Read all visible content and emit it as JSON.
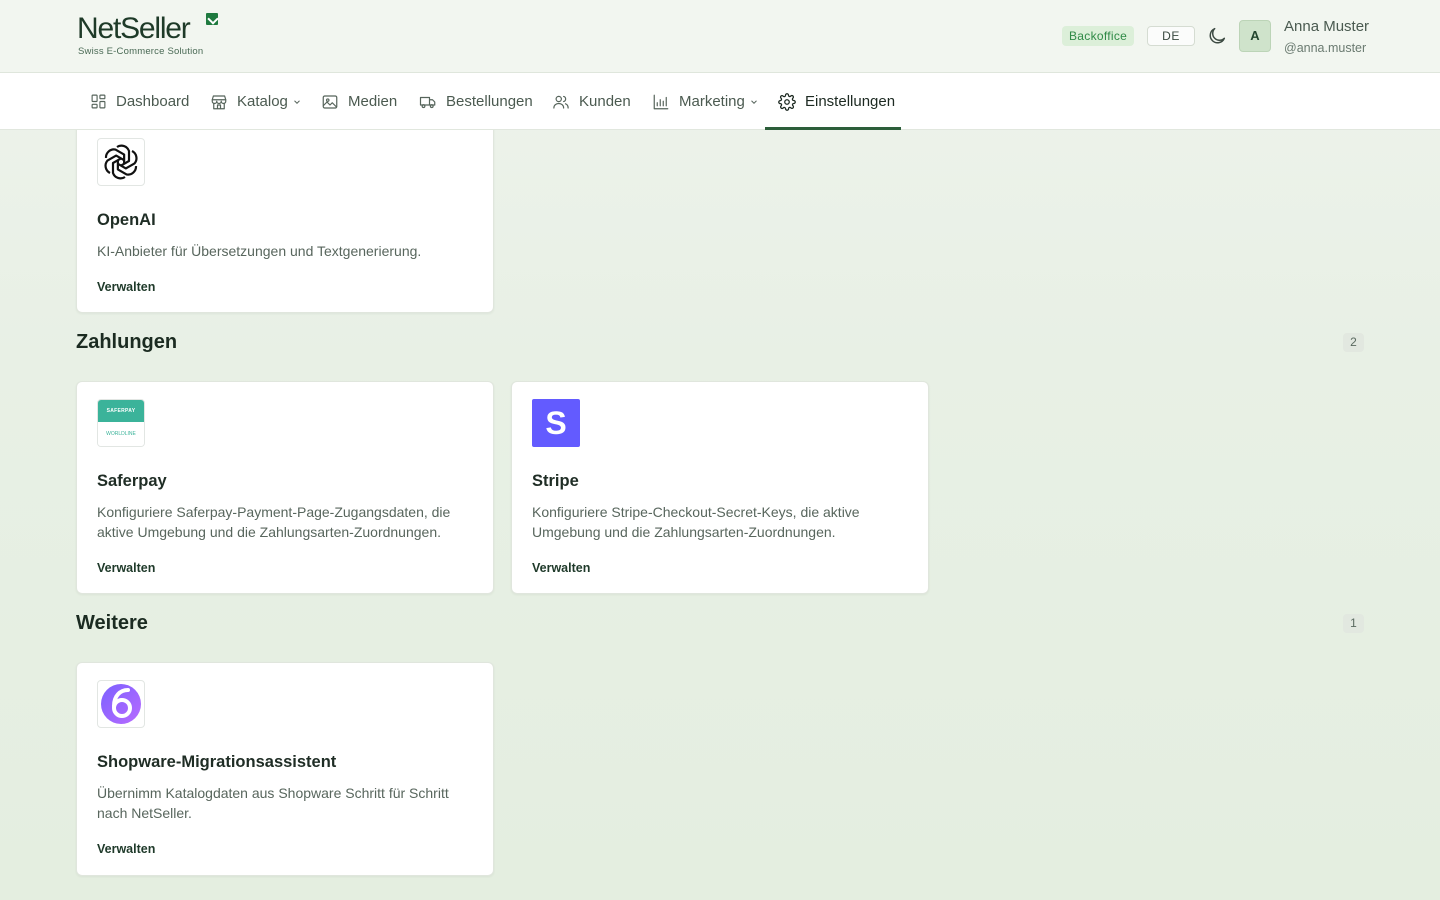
{
  "brand": {
    "name": "NetSeller",
    "tagline": "Swiss E-Commerce Solution"
  },
  "header": {
    "backoffice_badge": "Backoffice",
    "language": "DE",
    "user_initial": "A",
    "user_name": "Anna Muster",
    "user_handle": "@anna.muster"
  },
  "nav": {
    "items": [
      {
        "label": "Dashboard",
        "icon": "dashboard-icon"
      },
      {
        "label": "Katalog",
        "icon": "store-icon",
        "dropdown": true
      },
      {
        "label": "Medien",
        "icon": "image-icon"
      },
      {
        "label": "Bestellungen",
        "icon": "truck-icon"
      },
      {
        "label": "Kunden",
        "icon": "users-icon"
      },
      {
        "label": "Marketing",
        "icon": "chart-icon",
        "dropdown": true
      },
      {
        "label": "Einstellungen",
        "icon": "gear-icon",
        "active": true
      }
    ]
  },
  "cards": {
    "openai": {
      "title": "OpenAI",
      "description": "KI-Anbieter für Übersetzungen und Textgenerierung.",
      "link": "Verwalten"
    },
    "saferpay": {
      "title": "Saferpay",
      "description": "Konfiguriere Saferpay-Payment-Page-Zugangsdaten, die aktive Umgebung und die Zahlungsarten-Zuordnungen.",
      "link": "Verwalten",
      "logo_top": "SAFERPAY",
      "logo_bottom": "WORLDLINE"
    },
    "stripe": {
      "title": "Stripe",
      "description": "Konfiguriere Stripe-Checkout-Secret-Keys, die aktive Umgebung und die Zahlungsarten-Zuordnungen.",
      "link": "Verwalten",
      "logo_letter": "S"
    },
    "shopware": {
      "title": "Shopware-Migrationsassistent",
      "description": "Übernimm Katalogdaten aus Shopware Schritt für Schritt nach NetSeller.",
      "link": "Verwalten"
    }
  },
  "sections": {
    "payments": {
      "title": "Zahlungen",
      "count": "2"
    },
    "more": {
      "title": "Weitere",
      "count": "1"
    }
  },
  "colors": {
    "accent": "#2c5e3a",
    "stripe": "#635bff",
    "saferpay": "#3bb39a"
  }
}
